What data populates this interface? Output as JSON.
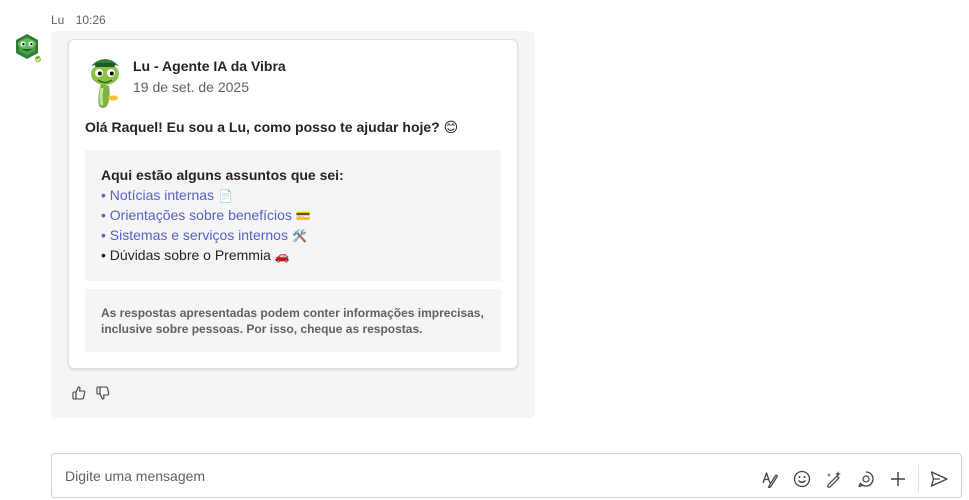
{
  "message": {
    "sender": "Lu",
    "time": "10:26",
    "avatar_icon": "turtle-bot-avatar-icon",
    "presence_color": "#6bb700"
  },
  "card": {
    "title": "Lu - Agente IA da Vibra",
    "date": "19 de set. de 2025",
    "greeting": "Olá Raquel! Eu sou a Lu, como posso te ajudar hoje?",
    "greeting_emoji": "😊",
    "topics_title": "Aqui estão alguns assuntos que sei:",
    "topics": [
      {
        "label": "• Notícias internas",
        "emoji": "📄",
        "link": true
      },
      {
        "label": "• Orientações sobre benefícios",
        "emoji": "💳",
        "link": true
      },
      {
        "label": "• Sistemas e serviços internos",
        "emoji": "🛠️",
        "link": true
      },
      {
        "label": "• Dúvidas sobre o Premmia",
        "emoji": "🚗",
        "link": false
      }
    ],
    "disclaimer": "As respostas apresentadas podem conter informações imprecisas, inclusive sobre pessoas. Por isso, cheque as respostas."
  },
  "reactions": [
    "thumbs-up-icon",
    "thumbs-down-icon"
  ],
  "composer": {
    "placeholder": "Digite uma mensagem",
    "tools": [
      "format-icon",
      "emoji-icon",
      "copilot-icon",
      "loop-icon",
      "add-icon",
      "send-icon"
    ]
  },
  "colors": {
    "link": "#5b5fc7",
    "bubble": "#f5f5f5",
    "text": "#242424",
    "muted": "#616161"
  }
}
